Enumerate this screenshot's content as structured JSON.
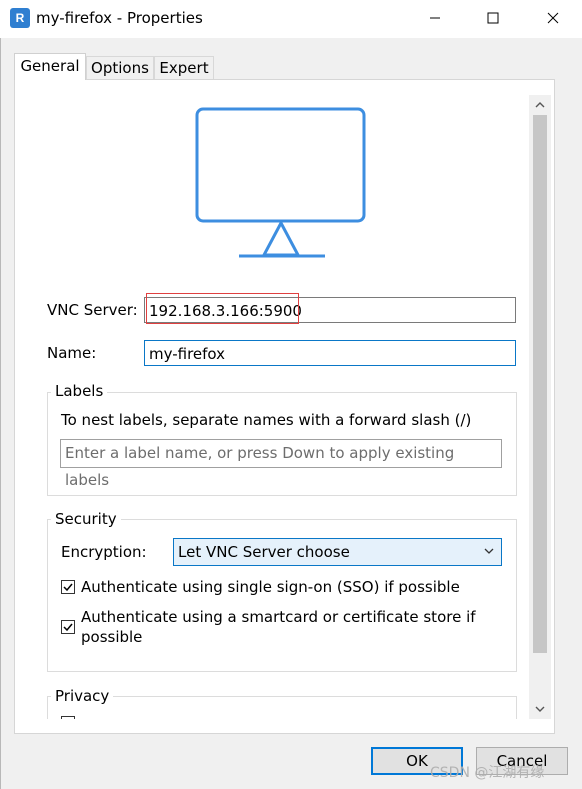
{
  "window": {
    "app_icon_text": "R",
    "title": "my-firefox - Properties",
    "min_icon": "minimize-icon",
    "max_icon": "maximize-icon",
    "close_icon": "close-icon"
  },
  "tabs": [
    {
      "label": "General",
      "active": true
    },
    {
      "label": "Options",
      "active": false
    },
    {
      "label": "Expert",
      "active": false
    }
  ],
  "general": {
    "monitor_icon": "monitor-icon",
    "vnc_server_label": "VNC Server:",
    "vnc_server_value": "192.168.3.166:5900",
    "name_label": "Name:",
    "name_value": "my-firefox",
    "labels_group": {
      "title": "Labels",
      "hint": "To nest labels, separate names with a forward slash (/)",
      "placeholder": "Enter a label name, or press Down to apply existing labels"
    },
    "security_group": {
      "title": "Security",
      "encryption_label": "Encryption:",
      "encryption_value": "Let VNC Server choose",
      "sso_label": "Authenticate using single sign-on (SSO) if possible",
      "sso_checked": true,
      "smartcard_label_line1": "Authenticate using a smartcard or certificate store if",
      "smartcard_label_line2": "possible",
      "smartcard_checked": true
    },
    "privacy_group": {
      "title": "Privacy"
    }
  },
  "buttons": {
    "ok": "OK",
    "cancel": "Cancel"
  },
  "watermark": "CSDN @江湖有缘",
  "colors": {
    "accent": "#0a77c7",
    "monitor_blue": "#3d8ee0",
    "highlight_red": "#e04040"
  }
}
